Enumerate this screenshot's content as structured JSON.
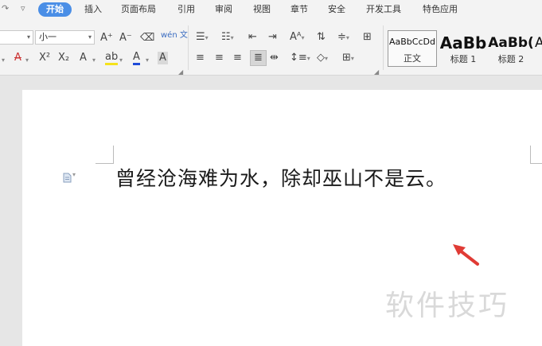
{
  "quick_access": {
    "undo_icon": "redo-icon",
    "more": "▿"
  },
  "tabs": [
    {
      "label": "开始",
      "active": true
    },
    {
      "label": "插入"
    },
    {
      "label": "页面布局"
    },
    {
      "label": "引用"
    },
    {
      "label": "审阅"
    },
    {
      "label": "视图"
    },
    {
      "label": "章节"
    },
    {
      "label": "安全"
    },
    {
      "label": "开发工具"
    },
    {
      "label": "特色应用"
    }
  ],
  "ribbon": {
    "font_size": "小一",
    "grow_font": "A⁺",
    "shrink_font": "A⁻",
    "clear_format": "⌫",
    "pinyin": "wén 文",
    "superscript": "X²",
    "subscript": "X₂",
    "font_color": "A",
    "char_shade": "A",
    "highlight": "ab",
    "strike": "A",
    "effect": "A",
    "styles": [
      {
        "sample": "AaBbCcDd",
        "name": "正文"
      },
      {
        "sample": "AaBb",
        "name": "标题 1"
      },
      {
        "sample": "AaBb(",
        "name": "标题 2"
      },
      {
        "sample": "A",
        "name": ""
      }
    ]
  },
  "document": {
    "text": "曾经沧海难为水，除却巫山不是云。",
    "watermark": "软件技巧"
  },
  "colors": {
    "accent": "#4a8ee6",
    "arrow": "#e03b35"
  }
}
